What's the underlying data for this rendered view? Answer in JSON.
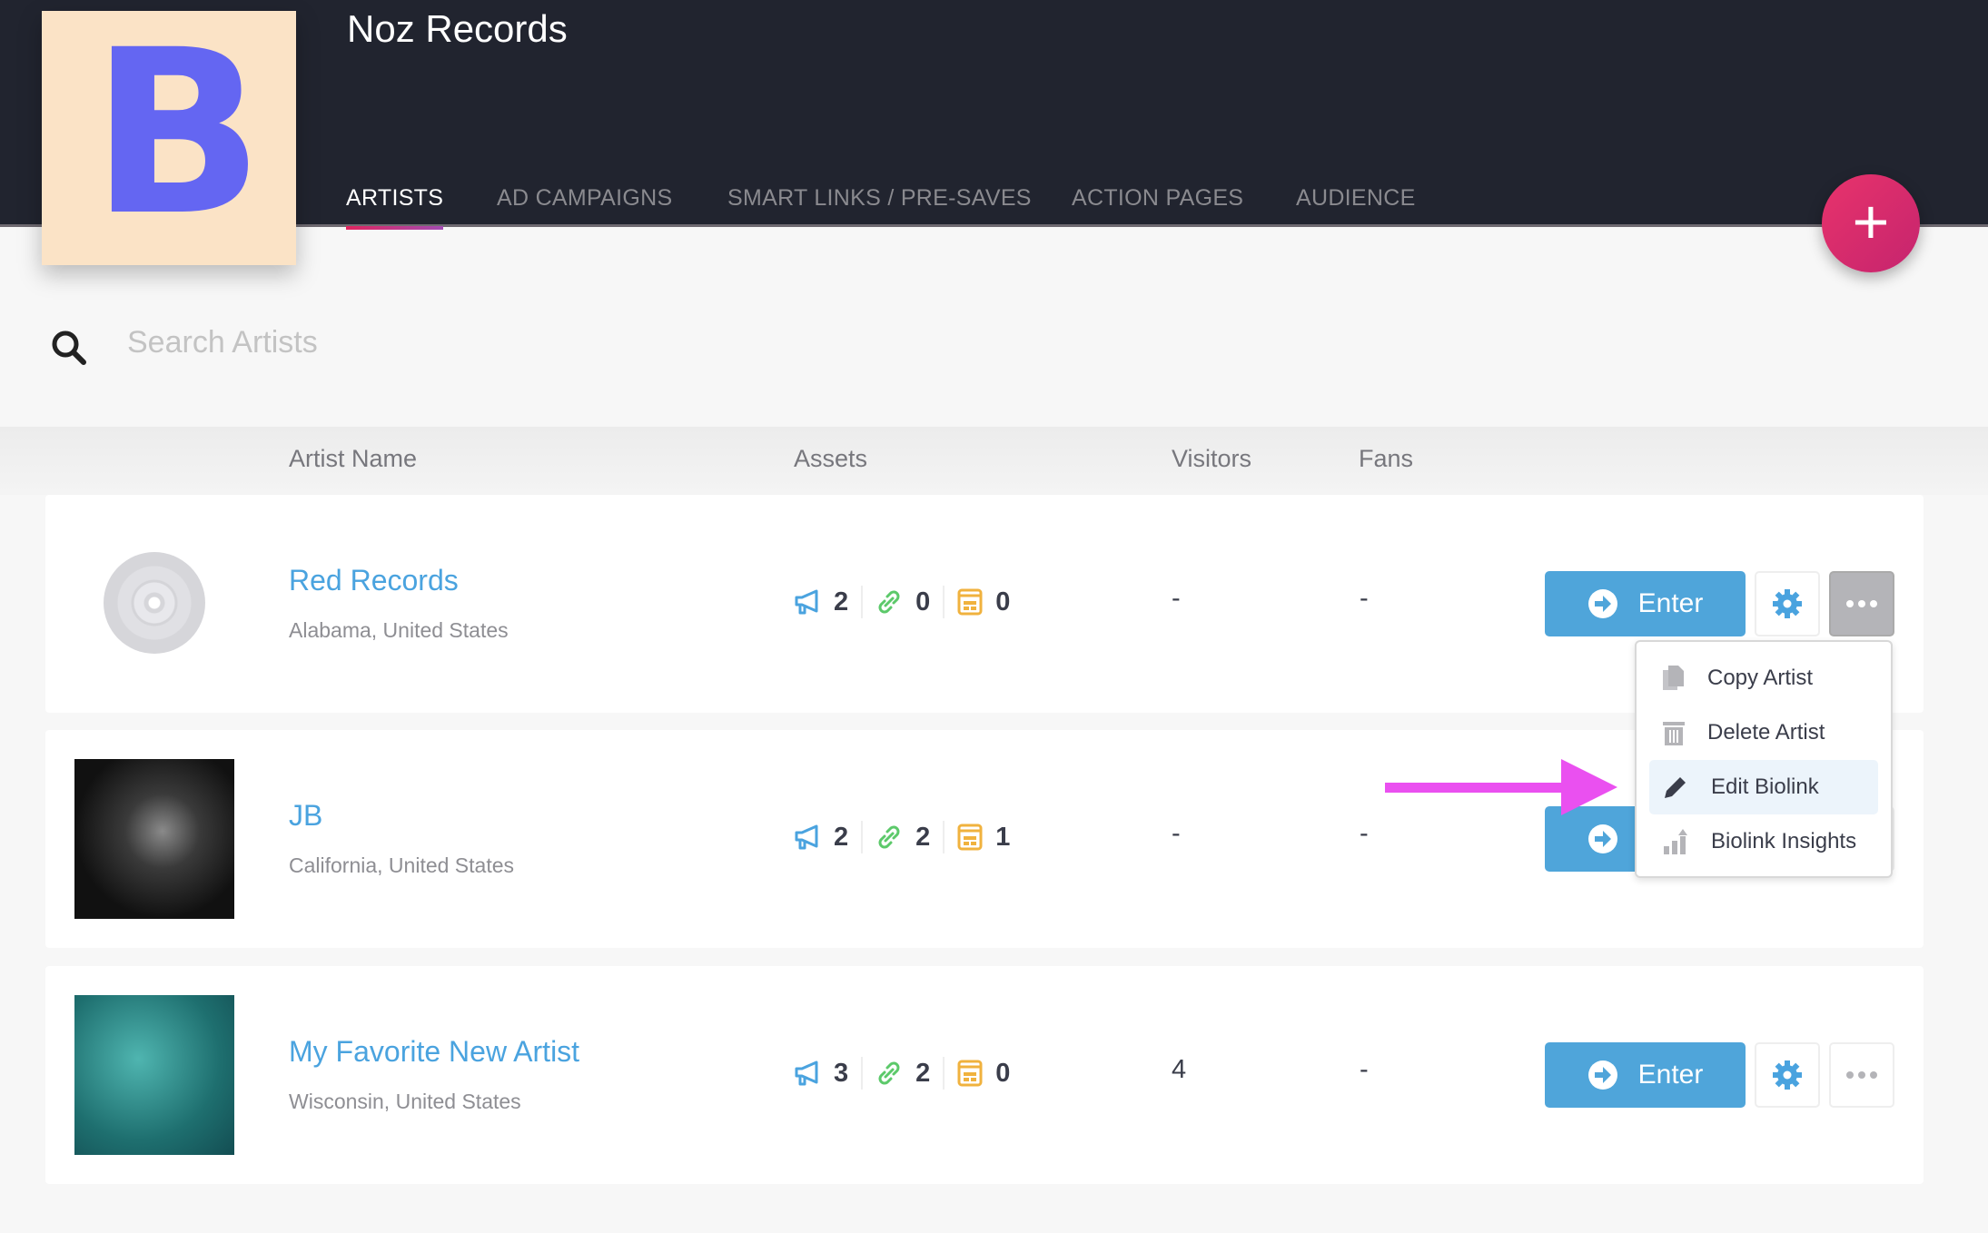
{
  "header": {
    "logo_letter": "B",
    "title": "Noz Records",
    "tabs": [
      {
        "label": "ARTISTS",
        "active": true
      },
      {
        "label": "AD CAMPAIGNS"
      },
      {
        "label": "SMART LINKS / PRE-SAVES"
      },
      {
        "label": "ACTION PAGES"
      },
      {
        "label": "AUDIENCE"
      }
    ],
    "add_label": "+"
  },
  "search": {
    "placeholder": "Search Artists",
    "value": ""
  },
  "table": {
    "headers": [
      "Artist Name",
      "Assets",
      "Visitors",
      "Fans"
    ],
    "rows": [
      {
        "name": "Red Records",
        "location": "Alabama, United States",
        "ads": "2",
        "links": "0",
        "pages": "0",
        "visitors": "-",
        "fans": "-",
        "avatar": "vinyl-placeholder"
      },
      {
        "name": "JB",
        "location": "California, United States",
        "ads": "2",
        "links": "2",
        "pages": "1",
        "visitors": "-",
        "fans": "-",
        "avatar": "guitarist-photo"
      },
      {
        "name": "My Favorite New Artist",
        "location": "Wisconsin, United States",
        "ads": "3",
        "links": "2",
        "pages": "0",
        "visitors": "4",
        "fans": "-",
        "avatar": "network-abstract-image"
      }
    ]
  },
  "buttons": {
    "enter": "Enter"
  },
  "menu": {
    "items": [
      {
        "label": "Copy Artist",
        "icon": "copy-icon"
      },
      {
        "label": "Delete Artist",
        "icon": "trash-icon"
      },
      {
        "label": "Edit Biolink",
        "icon": "pencil-icon",
        "highlighted": true
      },
      {
        "label": "Biolink Insights",
        "icon": "chart-icon"
      }
    ]
  },
  "colors": {
    "accent": "#4fa5da",
    "header": "#21242f",
    "fab": "#e0245e",
    "arrow": "#ea50f0",
    "logo_bg": "#fbe3c6",
    "logo_letter": "#6466f2"
  }
}
